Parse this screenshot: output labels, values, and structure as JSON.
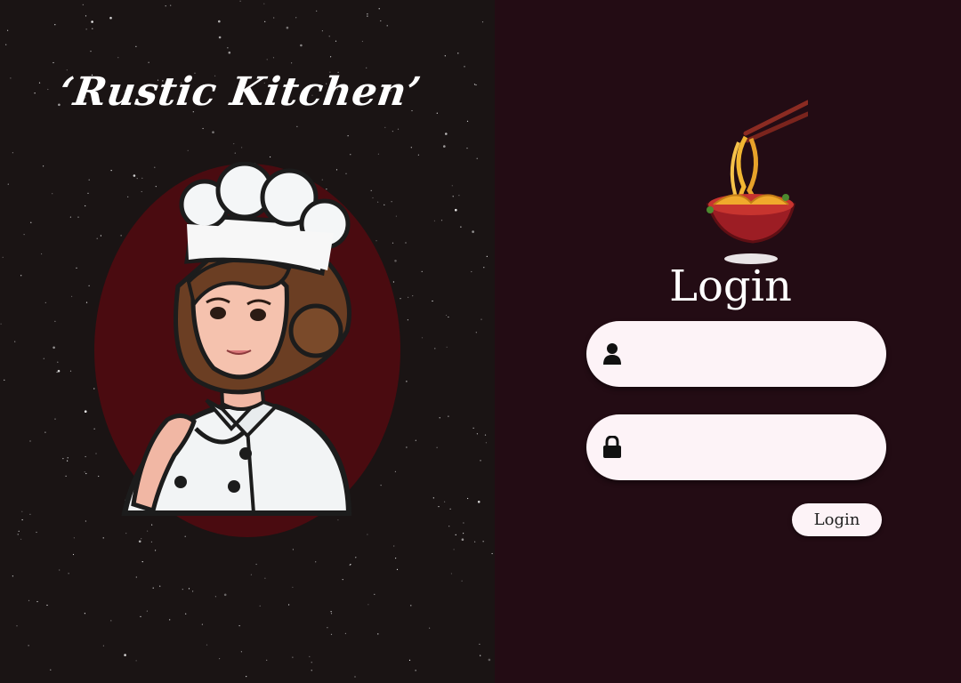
{
  "left_panel": {
    "brand_title": "‘Rustic Kitchen’",
    "background_color": "#1a1414",
    "illustration": "chef-woman-illustration",
    "accent_circle_color": "#4a0b10"
  },
  "right_panel": {
    "background_color": "#230c14",
    "logo": "noodle-bowl-chopsticks-icon",
    "heading": "Login",
    "username_field": {
      "icon": "user-icon",
      "value": "",
      "placeholder": ""
    },
    "password_field": {
      "icon": "lock-icon",
      "value": "",
      "placeholder": ""
    },
    "submit_label": "Login",
    "field_color": "#fdf3f7"
  }
}
